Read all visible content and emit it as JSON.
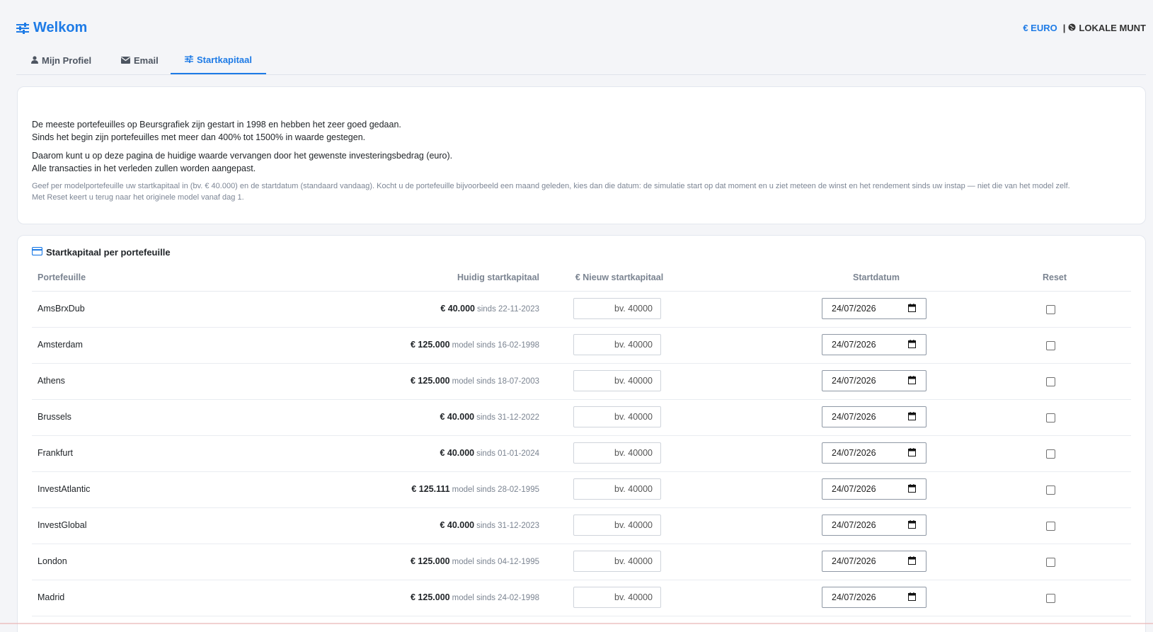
{
  "header": {
    "title": "Welkom",
    "currency_euro": "€ EURO",
    "currency_separator": "|",
    "currency_local": "LOKALE MUNT"
  },
  "tabs": [
    {
      "label": "Mijn Profiel",
      "icon": "user-icon"
    },
    {
      "label": "Email",
      "icon": "envelope-icon"
    },
    {
      "label": "Startkapitaal",
      "icon": "sliders-icon",
      "active": true
    }
  ],
  "intro": {
    "line1": "De meeste portefeuilles op Beursgrafiek zijn gestart in 1998 en hebben het zeer goed gedaan.",
    "line2": "Sinds het begin zijn portefeuilles met meer dan 400% tot 1500% in waarde gestegen.",
    "line3": "Daarom kunt u op deze pagina de huidige waarde vervangen door het gewenste investeringsbedrag (euro).",
    "line4": "Alle transacties in het verleden zullen worden aangepast.",
    "note1": "Geef per modelportefeuille uw startkapitaal in (bv. € 40.000) en de startdatum (standaard vandaag). Kocht u de portefeuille bijvoorbeeld een maand geleden, kies dan die datum: de simulatie start op dat moment en u ziet meteen de winst en het rendement sinds uw instap — niet die van het model zelf.",
    "note2": "Met Reset keert u terug naar het originele model vanaf dag 1."
  },
  "table": {
    "title": "Startkapitaal per portefeuille",
    "headers": {
      "name": "Portefeuille",
      "current": "Huidig startkapitaal",
      "new": "€ Nieuw startkapitaal",
      "date": "Startdatum",
      "reset": "Reset"
    },
    "amount_placeholder": "bv. 40000",
    "rows": [
      {
        "name": "AmsBrxDub",
        "amount": "€ 40.000",
        "since": "sinds 22-11-2023",
        "date": "24/07/2026"
      },
      {
        "name": "Amsterdam",
        "amount": "€ 125.000",
        "since": "model sinds 16-02-1998",
        "date": "24/07/2026"
      },
      {
        "name": "Athens",
        "amount": "€ 125.000",
        "since": "model sinds 18-07-2003",
        "date": "24/07/2026"
      },
      {
        "name": "Brussels",
        "amount": "€ 40.000",
        "since": "sinds 31-12-2022",
        "date": "24/07/2026"
      },
      {
        "name": "Frankfurt",
        "amount": "€ 40.000",
        "since": "sinds 01-01-2024",
        "date": "24/07/2026"
      },
      {
        "name": "InvestAtlantic",
        "amount": "€ 125.111",
        "since": "model sinds 28-02-1995",
        "date": "24/07/2026"
      },
      {
        "name": "InvestGlobal",
        "amount": "€ 40.000",
        "since": "sinds 31-12-2023",
        "date": "24/07/2026"
      },
      {
        "name": "London",
        "amount": "€ 125.000",
        "since": "model sinds 04-12-1995",
        "date": "24/07/2026"
      },
      {
        "name": "Madrid",
        "amount": "€ 125.000",
        "since": "model sinds 24-02-1998",
        "date": "24/07/2026"
      }
    ]
  },
  "colors": {
    "accent": "#1e7be6",
    "muted": "#7b8491"
  }
}
